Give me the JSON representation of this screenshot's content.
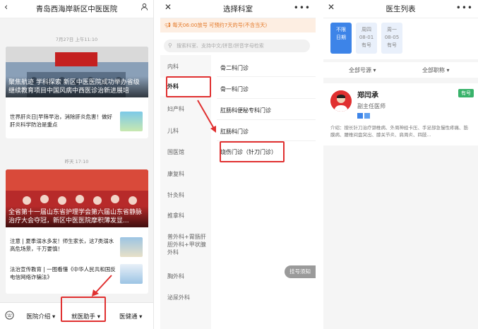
{
  "colors": {
    "accent": "#3d84e8",
    "highlight": "#e03030",
    "orange": "#e47a2b",
    "green": "#38b26a"
  },
  "panel1": {
    "title": "青岛西海岸新区中医医院",
    "back_icon": "chevron-left-icon",
    "user_icon": "person-icon",
    "time1": "7月27日 上午11:10",
    "hero1_caption": "聚焦航迹 学科探索 新区中医医院成功举办省级继续教育项目中国风病中西医诊治新进展培",
    "news1": "世界肝炎日|早筛早治，消除肝炎危害！做好肝炎科学防治是重点",
    "time2": "昨天 17:10",
    "hero2_caption": "全省第十一届山东省护理学会第六届山东省静脉治疗大会夺冠，新区中医医院摩积薄发显...",
    "news2": "注意 | 夏季溺水多发！师生家长，这7类溺水高危场景，千万要慎！",
    "news3": "法治宣传教育 | 一图看懂《中华人民共和国反电信网络诈骗法》",
    "nav": {
      "keyboard_icon": "keyboard-icon",
      "tab1": "医院介绍",
      "tab2": "就医助手",
      "tab3": "医健通"
    }
  },
  "panel2": {
    "title": "选择科室",
    "close_icon": "close-icon",
    "more_icon": "more-icon",
    "notice": "每天06:00放号 可预约7天的号(不含当天)",
    "search_placeholder": "搜索科室、支持中文/拼音/拼音字母检索",
    "departments": [
      "内科",
      "外科",
      "妇产科",
      "儿科",
      "国医馆",
      "康复科",
      "针灸科",
      "推拿科",
      "普外科+胃肠肝胆外科+甲状腺外科",
      "胸外科",
      "泌尿外科"
    ],
    "subdepartments": [
      "骨二科门诊",
      "骨一科门诊",
      "肛肠科便秘专科门诊",
      "肛肠科门诊",
      "烧伤门诊（针刀门诊）"
    ],
    "float_label": "挂号须知"
  },
  "panel3": {
    "title": "医生列表",
    "dates": [
      {
        "l1": "不限",
        "l2": "日期",
        "sel": true
      },
      {
        "l1": "周四",
        "l2": "08-01",
        "l3": "有号"
      },
      {
        "l1": "周一",
        "l2": "08-05",
        "l3": "有号"
      }
    ],
    "filter1": "全部号源",
    "filter2": "全部职称",
    "doctor": {
      "name": "郑闫承",
      "title": "副主任医师",
      "badge": "有号",
      "intro": "介绍：擅长针刀治疗颈椎病、外周神经卡压、手足部急慢性疼痛、筋膜病、腰椎间盘突出、膝关节炎、肩周炎、四肢..."
    }
  }
}
